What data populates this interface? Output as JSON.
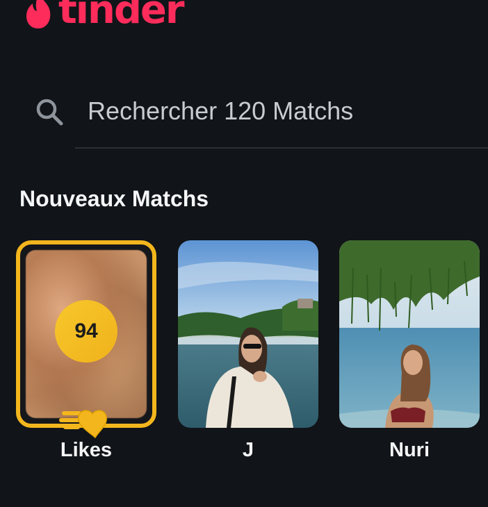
{
  "header": {
    "logo_text": "tinder",
    "brand_color": "#fd2c5b"
  },
  "search": {
    "placeholder": "Rechercher 120 Matchs",
    "icon": "search-icon"
  },
  "new_matches": {
    "title": "Nouveaux Matchs",
    "items": [
      {
        "label": "Likes",
        "count": "94",
        "accent_color": "#f3b61d",
        "icon": "gold-heart-icon"
      },
      {
        "label": "J"
      },
      {
        "label": "Nuri"
      }
    ]
  }
}
